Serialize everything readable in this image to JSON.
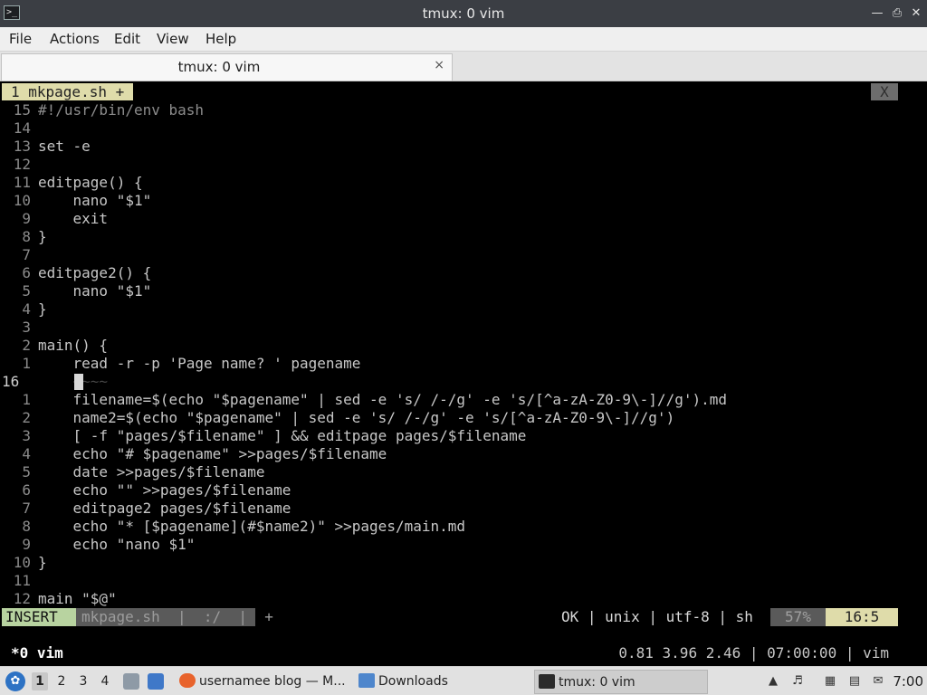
{
  "window": {
    "title": "tmux: 0 vim",
    "icon": "terminal-icon"
  },
  "menu": [
    "File",
    "Actions",
    "Edit",
    "View",
    "Help"
  ],
  "tab": {
    "title": "tmux: 0 vim",
    "close_glyph": "×"
  },
  "vim": {
    "tabline": {
      "active": "1 mkpage.sh  +",
      "close": "X"
    },
    "lines": [
      {
        "n": "15",
        "t": "#!/usr/bin/env bash",
        "cls": "cm"
      },
      {
        "n": "14",
        "t": ""
      },
      {
        "n": "13",
        "t": "set -e"
      },
      {
        "n": "12",
        "t": ""
      },
      {
        "n": "11",
        "t": "editpage() {"
      },
      {
        "n": "10",
        "t": "    nano \"$1\""
      },
      {
        "n": "9",
        "t": "    exit"
      },
      {
        "n": "8",
        "t": "}"
      },
      {
        "n": "7",
        "t": ""
      },
      {
        "n": "6",
        "t": "editpage2() {"
      },
      {
        "n": "5",
        "t": "    nano \"$1\""
      },
      {
        "n": "4",
        "t": "}"
      },
      {
        "n": "3",
        "t": ""
      },
      {
        "n": "2",
        "t": "main() {"
      },
      {
        "n": "1",
        "t": "    read -r -p 'Page name? ' pagename"
      },
      {
        "n": "16",
        "t": "    ~~~~",
        "current": true
      },
      {
        "n": "1",
        "t": "    filename=$(echo \"$pagename\" | sed -e 's/ /-/g' -e 's/[^a-zA-Z0-9\\-]//g').md"
      },
      {
        "n": "2",
        "t": "    name2=$(echo \"$pagename\" | sed -e 's/ /-/g' -e 's/[^a-zA-Z0-9\\-]//g')"
      },
      {
        "n": "3",
        "t": "    [ -f \"pages/$filename\" ] && editpage pages/$filename"
      },
      {
        "n": "4",
        "t": "    echo \"# $pagename\" >>pages/$filename"
      },
      {
        "n": "5",
        "t": "    date >>pages/$filename"
      },
      {
        "n": "6",
        "t": "    echo \"\" >>pages/$filename"
      },
      {
        "n": "7",
        "t": "    editpage2 pages/$filename"
      },
      {
        "n": "8",
        "t": "    echo \"* [$pagename](#$name2)\" >>pages/main.md"
      },
      {
        "n": "9",
        "t": "    echo \"nano $1\""
      },
      {
        "n": "10",
        "t": "}"
      },
      {
        "n": "11",
        "t": ""
      },
      {
        "n": "12",
        "t": "main \"$@\""
      }
    ],
    "status": {
      "mode": "INSERT",
      "file": "mkpage.sh  |  :/  |  +",
      "right": "OK | unix | utf-8 | sh",
      "percent": "57%",
      "position": "16:5",
      "colors": {
        "mode_bg": "#b8d3a0",
        "pos_bg": "#dfdcaa"
      }
    }
  },
  "tmux": {
    "window": "*0 vim",
    "right": "0.81 3.96 2.46 | 07:00:00 | vim"
  },
  "taskbar": {
    "workspaces": [
      "1",
      "2",
      "3",
      "4"
    ],
    "tasks": [
      {
        "label": "usernamee blog — M...",
        "icon": "firefox-icon"
      },
      {
        "label": "Downloads",
        "icon": "folder-icon"
      },
      {
        "label": "tmux: 0 vim",
        "icon": "terminal-icon"
      }
    ],
    "clock": "7:00"
  }
}
